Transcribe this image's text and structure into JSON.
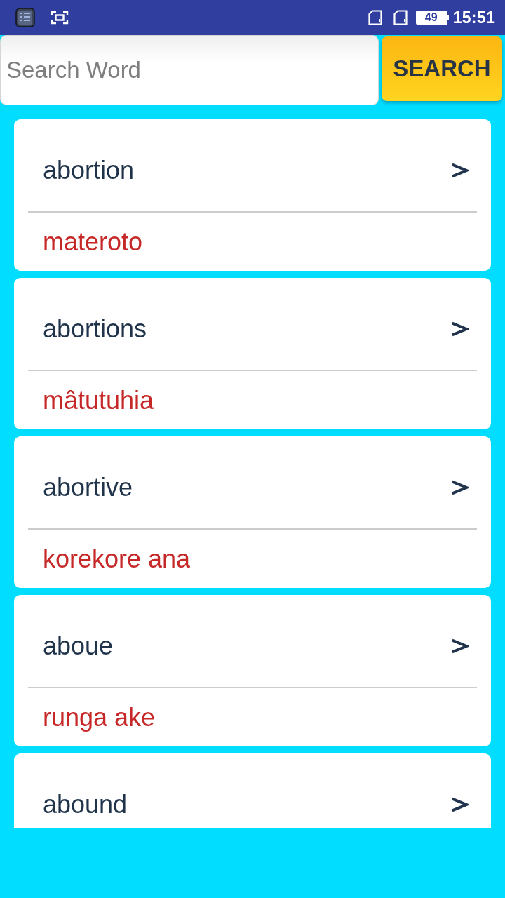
{
  "status_bar": {
    "battery": "49",
    "time": "15:51"
  },
  "search": {
    "placeholder": "Search Word",
    "button": "SEARCH"
  },
  "entries": [
    {
      "word": "abortion",
      "translation": "materoto"
    },
    {
      "word": "abortions",
      "translation": "mâtutuhia"
    },
    {
      "word": "abortive",
      "translation": "korekore ana"
    },
    {
      "word": "aboue",
      "translation": "runga ake"
    },
    {
      "word": "abound"
    }
  ]
}
